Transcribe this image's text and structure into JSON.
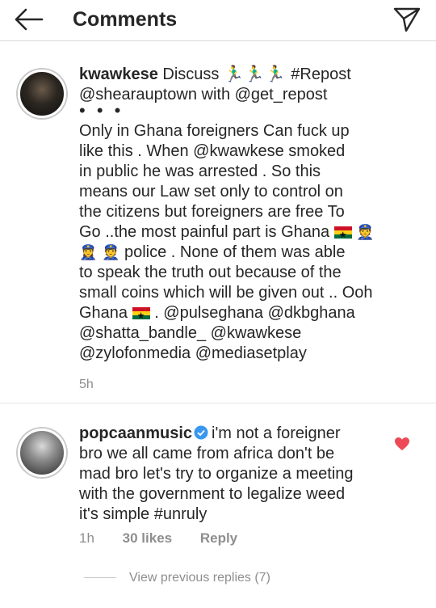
{
  "header": {
    "title": "Comments"
  },
  "caption": {
    "username": "kwawkese",
    "first_line_rest": " Discuss ",
    "first_line_emoji": "🏃‍♂️🏃‍♂️🏃‍♂️",
    "hashtag": " #Repost",
    "line2": "@shearauptown with @get_repost",
    "dots": "• • •",
    "body_lines": [
      "Only in Ghana foreigners Can fuck up",
      "like this . When @kwawkese smoked",
      "in public he was arrested . So this",
      "means our Law set only to control on",
      "the citizens but foreigners are free To",
      "Go ..the most painful part is Ghana",
      "police . None of them was able",
      "to speak the truth out because of the",
      "small coins which will be given out .. Ooh",
      "Ghana",
      ". @pulseghana @dkbghana",
      "@shatta_bandle_ @kwawkese",
      "@zylofonmedia @mediasetplay"
    ],
    "time": "5h"
  },
  "reply": {
    "username": "popcaanmusic",
    "lines": [
      "i'm not a foreigner",
      "bro we all came from africa don't be",
      "mad bro let's try to organize a meeting",
      "with the government to legalize weed",
      "it's simple #unruly"
    ],
    "time": "1h",
    "likes": "30 likes",
    "reply_label": "Reply",
    "view_previous": "View previous replies (7)"
  },
  "colors": {
    "heart": "#ed4956",
    "verified": "#3897f0",
    "muted": "#8e8e8e"
  }
}
